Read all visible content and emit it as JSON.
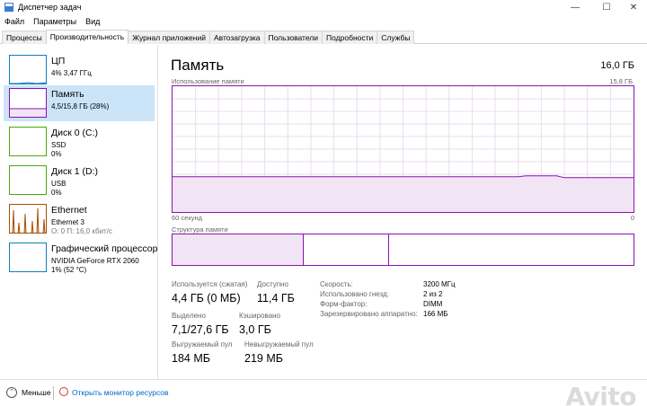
{
  "window": {
    "title": "Диспетчер задач",
    "minimize_glyph": "—",
    "maximize_glyph": "☐",
    "close_glyph": "✕"
  },
  "menu": [
    "Файл",
    "Параметры",
    "Вид"
  ],
  "tabs": [
    {
      "label": "Процессы",
      "active": false
    },
    {
      "label": "Производительность",
      "active": true
    },
    {
      "label": "Журнал приложений",
      "active": false
    },
    {
      "label": "Автозагрузка",
      "active": false
    },
    {
      "label": "Пользователи",
      "active": false
    },
    {
      "label": "Подробности",
      "active": false
    },
    {
      "label": "Службы",
      "active": false
    }
  ],
  "sidebar": {
    "items": [
      {
        "title": "ЦП",
        "sub1": "4% 3,47 ГГц",
        "sub2": "",
        "color": "#117dbb",
        "selected": false
      },
      {
        "title": "Память",
        "sub1": "4,5/15,8 ГБ (28%)",
        "sub2": "",
        "color": "#8b12ae",
        "selected": true
      },
      {
        "title": "Диск 0 (C:)",
        "sub1": "SSD",
        "sub2": "0%",
        "color": "#4da60c",
        "selected": false
      },
      {
        "title": "Диск 1 (D:)",
        "sub1": "USB",
        "sub2": "0%",
        "color": "#4da60c",
        "selected": false
      },
      {
        "title": "Ethernet",
        "sub1": "Ethernet 3",
        "sub2": "О: 0  П: 16,0 кбит/с",
        "color": "#a74f01",
        "selected": false
      },
      {
        "title": "Графический процессор",
        "sub1": "NVIDIA GeForce RTX 2060",
        "sub2": "1% (52 °C)",
        "color": "#117dbb",
        "selected": false
      }
    ]
  },
  "main": {
    "title": "Память",
    "total": "16,0 ГБ",
    "graph_caption": "Использование памяти",
    "graph_max": "15,8 ГБ",
    "graph_time_left": "60 секунд",
    "graph_time_right": "0",
    "usage_fraction": 0.28,
    "struct_caption": "Структура памяти",
    "struct_segments": [
      0.285,
      0.185
    ],
    "stats": {
      "in_use_label": "Используется (сжатая)",
      "in_use_value": "4,4 ГБ (0 МБ)",
      "available_label": "Доступно",
      "available_value": "11,4 ГБ",
      "committed_label": "Выделено",
      "committed_value": "7,1/27,6 ГБ",
      "cached_label": "Кэшировано",
      "cached_value": "3,0 ГБ",
      "paged_label": "Выгружаемый пул",
      "paged_value": "184 МБ",
      "nonpaged_label": "Невыгружаемый пул",
      "nonpaged_value": "219 МБ"
    },
    "details": [
      {
        "label": "Скорость:",
        "value": "3200 МГц"
      },
      {
        "label": "Использовано гнезд:",
        "value": "2 из 2"
      },
      {
        "label": "Форм-фактор:",
        "value": "DIMM"
      },
      {
        "label": "Зарезервировано аппаратно:",
        "value": "166 МБ"
      }
    ]
  },
  "footer": {
    "less_label": "Меньше",
    "resmon_label": "Открыть монитор ресурсов",
    "watermark": "Avito"
  },
  "colors": {
    "memory": "#8b12ae",
    "memory_fill": "#f1e5f5",
    "cpu": "#117dbb",
    "disk": "#4da60c",
    "ethernet": "#a74f01",
    "selected_bg": "#cce4f7",
    "link": "#0066cc"
  }
}
